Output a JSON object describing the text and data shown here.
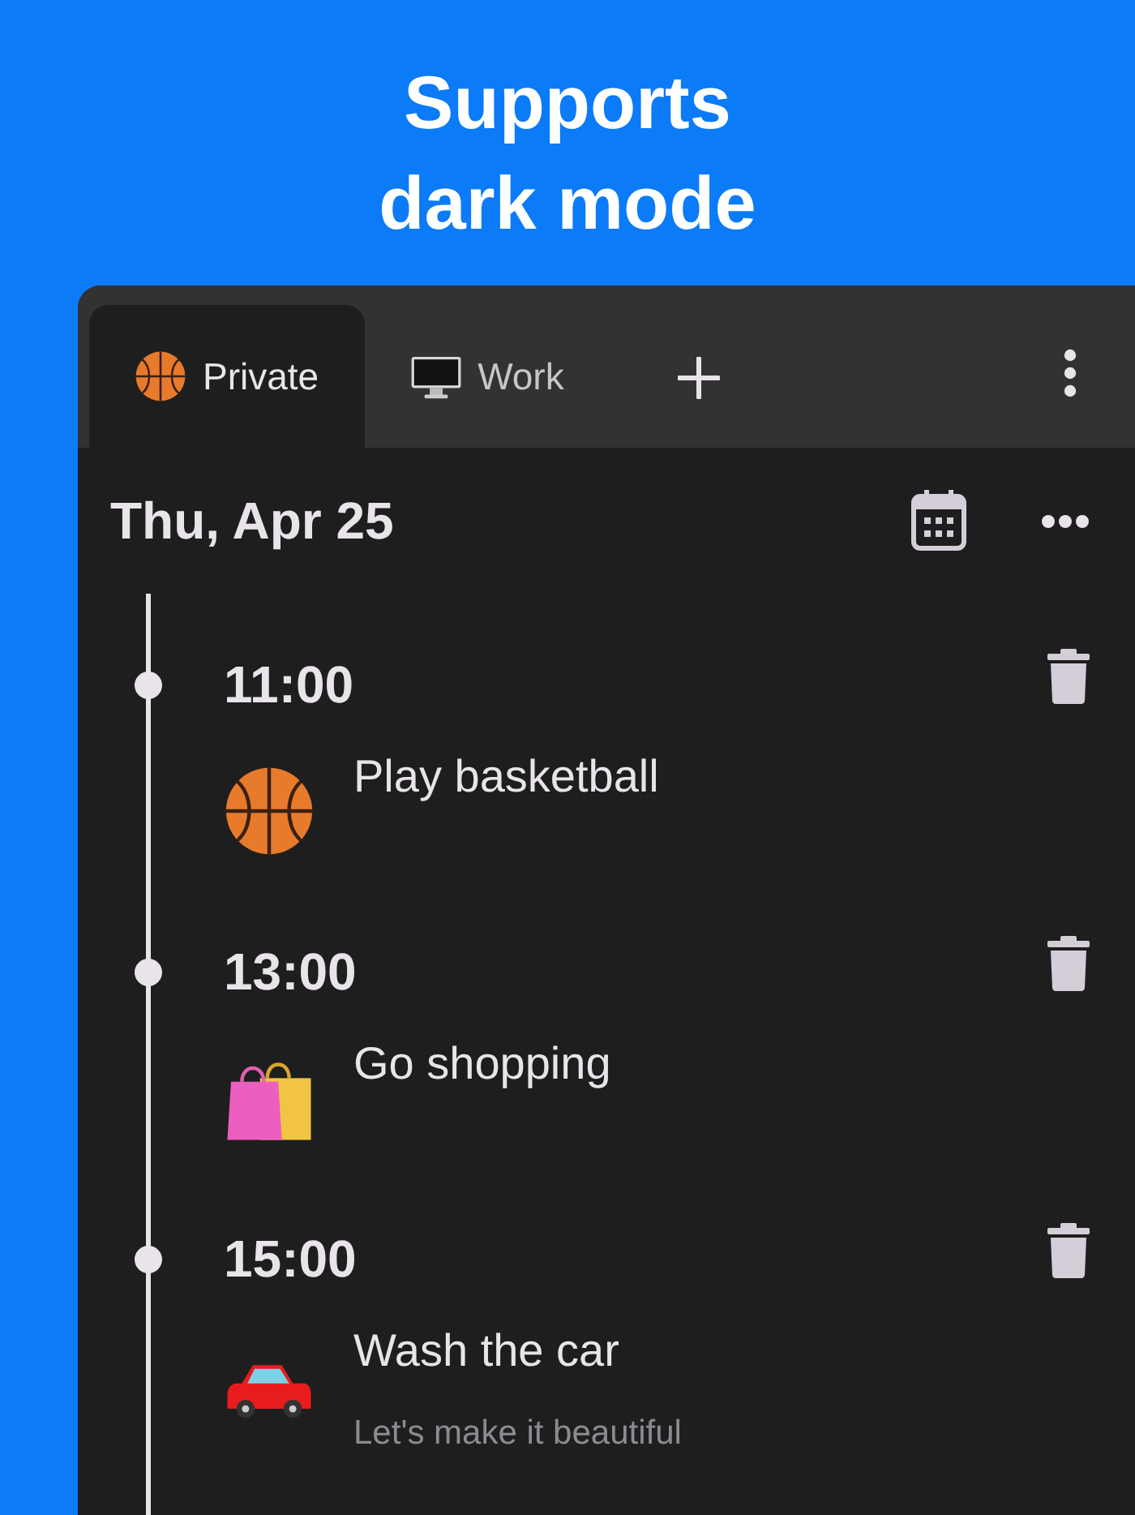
{
  "headline": [
    "Supports",
    "dark mode"
  ],
  "tabs": [
    {
      "label": "Private",
      "kind": "basketball",
      "selected": true
    },
    {
      "label": "Work",
      "kind": "monitor",
      "selected": false
    }
  ],
  "date": "Thu, Apr 25",
  "events": [
    {
      "time": "11:00",
      "title": "Play basketball",
      "kind": "basketball"
    },
    {
      "time": "13:00",
      "title": "Go shopping",
      "kind": "bags"
    },
    {
      "time": "15:00",
      "title": "Wash the car",
      "kind": "car",
      "note": "Let's make it beautiful"
    }
  ]
}
